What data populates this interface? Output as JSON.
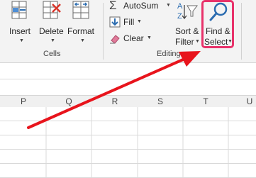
{
  "cells_group": {
    "label": "Cells",
    "insert_label": "Insert",
    "delete_label": "Delete",
    "format_label": "Format"
  },
  "editing_group": {
    "label": "Editing",
    "autosum_label": "AutoSum",
    "fill_label": "Fill",
    "clear_label": "Clear",
    "sort_filter_line1": "Sort &",
    "sort_filter_line2": "Filter",
    "find_select_line1": "Find &",
    "find_select_line2": "Select"
  },
  "columns": [
    "P",
    "Q",
    "R",
    "S",
    "T",
    "U"
  ],
  "colors": {
    "highlight": "#e8326a",
    "arrow": "#e8141c",
    "accent_blue": "#2b6cb0"
  }
}
